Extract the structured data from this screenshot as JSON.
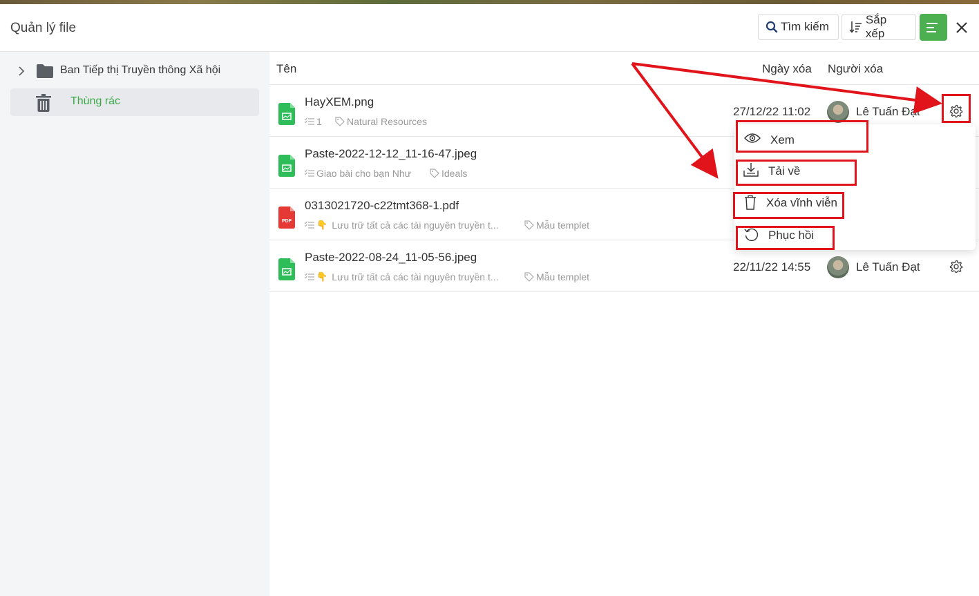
{
  "header": {
    "title": "Quản lý file",
    "search_label": "Tìm kiếm",
    "sort_label": "Sắp xếp"
  },
  "sidebar": {
    "items": [
      {
        "label": "Ban Tiếp thị Truyền thông Xã hội",
        "icon": "folder-icon"
      },
      {
        "label": "Thùng rác",
        "icon": "trash-icon",
        "active": true
      }
    ]
  },
  "columns": {
    "name": "Tên",
    "deleted_date": "Ngày xóa",
    "deleted_by": "Người xóa"
  },
  "files": [
    {
      "name": "HayXEM.png",
      "type": "image",
      "meta1": "1",
      "tag": "Natural Resources",
      "date": "27/12/22 11:02",
      "user": "Lê Tuấn Đạt"
    },
    {
      "name": "Paste-2022-12-12_11-16-47.jpeg",
      "type": "image",
      "meta1": "Giao bài cho bạn Như",
      "tag": "Ideals",
      "date": "",
      "user": ""
    },
    {
      "name": "0313021720-c22tmt368-1.pdf",
      "type": "pdf",
      "pdf_badge": "PDF",
      "meta1": "Lưu trữ tất cả các tài nguyên truyền t...",
      "tag": "Mẫu templet",
      "date": "",
      "user": ""
    },
    {
      "name": "Paste-2022-08-24_11-05-56.jpeg",
      "type": "image",
      "meta1": "Lưu trữ tất cả các tài nguyên truyền t...",
      "tag": "Mẫu templet",
      "date": "22/11/22 14:55",
      "user": "Lê Tuấn Đạt"
    }
  ],
  "context_menu": {
    "view": "Xem",
    "download": "Tải về",
    "delete_forever": "Xóa vĩnh viễn",
    "restore": "Phục hồi"
  },
  "colors": {
    "accent_green": "#4caf50",
    "annotation_red": "#e0141a",
    "image_file_green": "#2ebd59",
    "pdf_red": "#e53935"
  }
}
